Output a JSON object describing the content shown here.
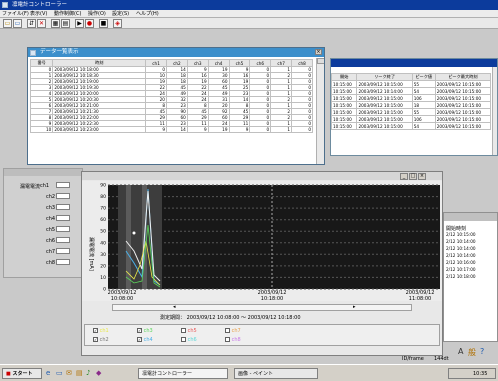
{
  "app": {
    "title": "凛電計コントローラー",
    "menus": [
      "ファイル(F)",
      "表示(V)",
      "動作制御(C)",
      "操作(O)",
      "設定(S)",
      "ヘルプ(H)"
    ],
    "toolbar_icons": [
      "open-icon",
      "save-icon",
      "connect-icon",
      "disconnect-icon",
      "grid-icon",
      "list-icon",
      "play-icon",
      "record-icon",
      "stop-icon",
      "chart-icon"
    ],
    "toolbar_glyphs": [
      "▭",
      "▭",
      "⇵",
      "✕",
      "▦",
      "▤",
      "▶",
      "●",
      "■",
      "◈"
    ]
  },
  "data_window": {
    "title": "データ一覧表示",
    "columns": [
      "番号",
      "時刻",
      "ch1",
      "ch2",
      "ch3",
      "ch4",
      "ch5",
      "ch6",
      "ch7",
      "ch8"
    ],
    "rows": [
      [
        "0",
        "2003/09/12 10:18:00",
        "0",
        "14",
        "9",
        "19",
        "9",
        "0",
        "1",
        "0"
      ],
      [
        "1",
        "2003/09/12 10:18:30",
        "10",
        "18",
        "16",
        "30",
        "16",
        "0",
        "2",
        "0"
      ],
      [
        "2",
        "2003/09/12 10:19:00",
        "19",
        "18",
        "19",
        "60",
        "19",
        "0",
        "1",
        "0"
      ],
      [
        "3",
        "2003/09/12 10:19:30",
        "22",
        "45",
        "22",
        "45",
        "25",
        "0",
        "1",
        "0"
      ],
      [
        "4",
        "2003/09/12 10:20:00",
        "24",
        "49",
        "24",
        "49",
        "23",
        "0",
        "1",
        "0"
      ],
      [
        "5",
        "2003/09/12 10:20:30",
        "20",
        "32",
        "24",
        "31",
        "14",
        "0",
        "2",
        "0"
      ],
      [
        "6",
        "2003/09/12 10:21:00",
        "8",
        "23",
        "8",
        "20",
        "8",
        "0",
        "1",
        "0"
      ],
      [
        "7",
        "2003/09/12 10:21:30",
        "45",
        "90",
        "45",
        "92",
        "45",
        "0",
        "2",
        "0"
      ],
      [
        "8",
        "2003/09/12 10:22:00",
        "29",
        "60",
        "29",
        "60",
        "29",
        "0",
        "2",
        "0"
      ],
      [
        "9",
        "2003/09/12 10:22:30",
        "11",
        "23",
        "11",
        "24",
        "11",
        "0",
        "1",
        "0"
      ],
      [
        "10",
        "2003/09/12 10:23:00",
        "9",
        "14",
        "9",
        "19",
        "9",
        "0",
        "1",
        "0"
      ]
    ]
  },
  "summary_window": {
    "columns": [
      "開始",
      "リーク終了",
      "ピーク値",
      "ピーク最大時刻"
    ],
    "rows": [
      [
        "10:15:00",
        "2003/09/12 10:15:00",
        "55",
        "2003/09/12 10:15:00"
      ],
      [
        "10:15:00",
        "2003/09/12 10:14:00",
        "54",
        "2003/09/12 10:15:00"
      ],
      [
        "10:15:00",
        "2003/09/12 10:15:00",
        "106",
        "2003/09/12 10:15:00"
      ],
      [
        "10:15:00",
        "2003/09/12 10:15:00",
        "18",
        "2003/09/12 10:15:00"
      ],
      [
        "10:15:00",
        "2003/09/12 10:15:00",
        "55",
        "2003/09/12 10:15:00"
      ],
      [
        "10:15:00",
        "2003/09/12 10:15:00",
        "106",
        "2003/09/12 10:15:00"
      ],
      [
        "10:15:00",
        "2003/09/12 10:15:00",
        "54",
        "2003/09/12 10:15:00"
      ]
    ]
  },
  "left_panel": {
    "title_label": "漏電電流",
    "channels": [
      "ch1",
      "ch2",
      "ch3",
      "ch4",
      "ch5",
      "ch6",
      "ch7",
      "ch8"
    ]
  },
  "graph_window": {
    "ylabel": "漏電電流 [mA]",
    "yticks": [
      "90",
      "80",
      "70",
      "60",
      "50",
      "40",
      "30",
      "20",
      "10",
      "0"
    ],
    "x_left": "2003/09/12\n10:08:00",
    "x_mid": "2003/09/12\n10:18:00",
    "x_right": "2003/09/12\n11:08:00",
    "period": "測定期間： 2003/09/12 10:08:00 〜 2003/09/12 10:18:00",
    "legend": [
      {
        "label": "ch1",
        "color": "#e8e84a",
        "checked": true
      },
      {
        "label": "ch2",
        "color": "#f0f0f0",
        "checked": true
      },
      {
        "label": "ch3",
        "color": "#5cd65c",
        "checked": true
      },
      {
        "label": "ch4",
        "color": "#4ab0e8",
        "checked": true
      },
      {
        "label": "ch5",
        "color": "#e85a5a",
        "checked": false
      },
      {
        "label": "ch6",
        "color": "#5ad6d6",
        "checked": false
      },
      {
        "label": "ch7",
        "color": "#e8a04a",
        "checked": false
      },
      {
        "label": "ch8",
        "color": "#c87ae8",
        "checked": false
      }
    ]
  },
  "right_list": {
    "header": "開始時刻",
    "items": [
      "2/12 10:15:00",
      "2/12 10:14:00",
      "2/12 10:14:00",
      "2/12 10:14:00",
      "2/12 10:16:00",
      "2/12 10:17:00",
      "2/12 10:18:00"
    ]
  },
  "statusbar": {
    "text": "ID/frame",
    "value": "144dt"
  },
  "taskbar": {
    "start": "スタート",
    "tasks": [
      "凛電計コントローラー",
      "画像 - ペイント"
    ],
    "clock": "10:35"
  }
}
